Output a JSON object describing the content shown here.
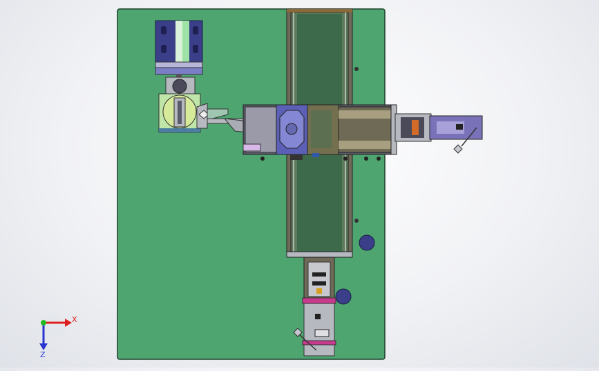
{
  "viewport": {
    "background": "#f1f2f5"
  },
  "model": {
    "baseplate_color": "#4ea570",
    "frame_color": "#2f6b47",
    "metal_color": "#6b6250",
    "blue_accent": "#5b5fb5",
    "purple_accent": "#9a66b0",
    "gray_part": "#b7b9c1",
    "pink_band": "#c93a8f"
  },
  "triad": {
    "x_label": "X",
    "z_label": "Z",
    "x_color": "#e02020",
    "y_color": "#22bb22",
    "z_color": "#2a35d0"
  }
}
